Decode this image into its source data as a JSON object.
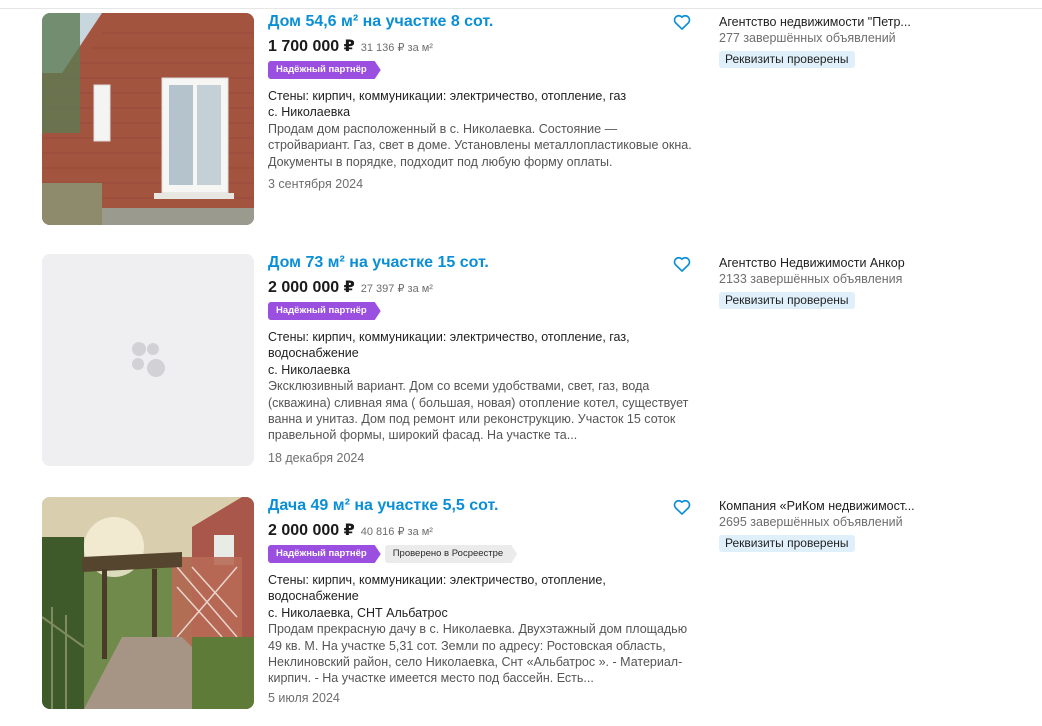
{
  "listings": [
    {
      "title": "Дом 54,6 м² на участке 8 сот.",
      "price": "1 700 000 ₽",
      "price_per_m2": "31 136 ₽ за м²",
      "badges": [
        "Надёжный партнёр"
      ],
      "features": "Стены: кирпич, коммуникации: электричество, отопление, газ",
      "location": "с. Николаевка",
      "description": "Продам дом расположенный в с. Николаевка. Состояние — стройвариант. Газ, свет в доме. Установлены металлопластиковые окна. Документы в порядке, подходит под любую форму оплаты.",
      "date": "3 сентября 2024",
      "seller_name": "Агентство недвижимости \"Петр...",
      "seller_count": "277 завершённых объявлений",
      "seller_badge": "Реквизиты проверены"
    },
    {
      "title": "Дом 73 м² на участке 15 сот.",
      "price": "2 000 000 ₽",
      "price_per_m2": "27 397 ₽ за м²",
      "badges": [
        "Надёжный партнёр"
      ],
      "features": "Стены: кирпич, коммуникации: электричество, отопление, газ, водоснабжение",
      "location": "с. Николаевка",
      "description": "Эксклюзивный вариант. Дом со всеми удобствами, свет, газ, вода (скважина) сливная яма ( большая, новая) отопление котел, существует ванна и унитаз. Дом под ремонт или реконструкцию. Участок 15 соток правельной формы, широкий фасад. На участке та...",
      "date": "18 декабря 2024",
      "seller_name": "Агентство Недвижимости Анкор",
      "seller_count": "2133 завершённых объявления",
      "seller_badge": "Реквизиты проверены"
    },
    {
      "title": "Дача 49 м² на участке 5,5 сот.",
      "price": "2 000 000 ₽",
      "price_per_m2": "40 816 ₽ за м²",
      "badges": [
        "Надёжный партнёр",
        "Проверено в Росреестре"
      ],
      "features": "Стены: кирпич, коммуникации: электричество, отопление, водоснабжение",
      "location": "с. Николаевка, СНТ Альбатрос",
      "description": "Продам прекрасную дачу в с. Николаевка. Двухэтажный дом площадью 49 кв. М. На участке 5,31 сот. Земли по адресу: Ростовская область, Неклиновский район, село Николаевка, Снт «Альбатрос ». - Материал- кирпич. - На участке имеется место под бассейн. Есть...",
      "date": "5 июля 2024",
      "seller_name": "Компания «РиКом недвижимост...",
      "seller_count": "2695 завершённых объявлений",
      "seller_badge": "Реквизиты проверены"
    }
  ],
  "icons": {
    "favorite": "heart-icon",
    "placeholder": "photo-placeholder-icon"
  },
  "colors": {
    "title_link": "#0a8fd6",
    "partner_badge": "#9b4fe0",
    "registry_badge": "#ebebeb",
    "seller_badge_bg": "#dff0fb",
    "favorite_icon": "#0a8fd6"
  }
}
